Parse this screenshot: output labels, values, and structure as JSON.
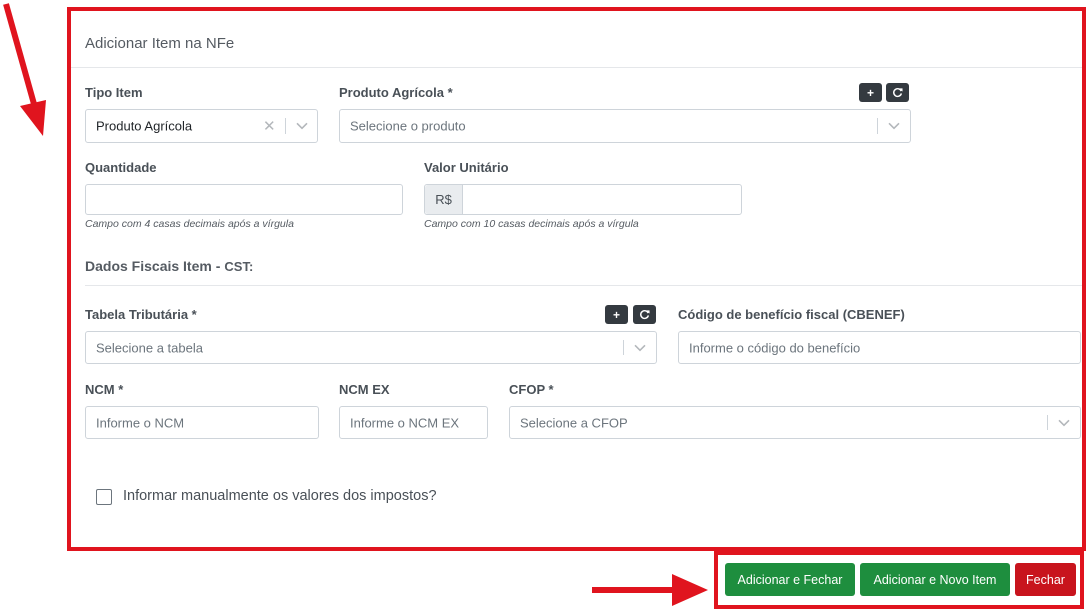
{
  "modal": {
    "title": "Adicionar Item na NFe"
  },
  "fields": {
    "tipo_item": {
      "label": "Tipo Item",
      "value": "Produto Agrícola"
    },
    "produto": {
      "label": "Produto Agrícola *",
      "placeholder": "Selecione o produto",
      "add_label": "+",
      "refresh_label": "⟳"
    },
    "quantidade": {
      "label": "Quantidade",
      "hint": "Campo com 4 casas decimais após a vírgula"
    },
    "valor_unitario": {
      "label": "Valor Unitário",
      "prefix": "R$",
      "hint": "Campo com 10 casas decimais após a vírgula"
    },
    "tabela": {
      "label": "Tabela Tributária *",
      "placeholder": "Selecione a tabela",
      "add_label": "+",
      "refresh_label": "⟳"
    },
    "cbenef": {
      "label": "Código de benefício fiscal (CBENEF)",
      "placeholder": "Informe o código do benefício"
    },
    "ncm": {
      "label": "NCM *",
      "placeholder": "Informe o NCM"
    },
    "ncm_ex": {
      "label": "NCM EX",
      "placeholder": "Informe o NCM EX"
    },
    "cfop": {
      "label": "CFOP *",
      "placeholder": "Selecione a CFOP"
    }
  },
  "section": {
    "title": "Dados Fiscais Item -",
    "cst": "CST:"
  },
  "manual_taxes": {
    "label": "Informar manualmente os valores dos impostos?",
    "checked": false
  },
  "footer": {
    "add_close": "Adicionar e Fechar",
    "add_new": "Adicionar e Novo Item",
    "close": "Fechar"
  },
  "colors": {
    "highlight": "#e0141e",
    "green": "#1e8e3e",
    "red": "#c8141d",
    "dark": "#343a40"
  },
  "icons": {
    "arrow": "red-arrow-icon",
    "chevron": "chevron-down-icon",
    "clear": "clear-x-icon",
    "plus": "plus-icon",
    "refresh": "refresh-icon"
  }
}
